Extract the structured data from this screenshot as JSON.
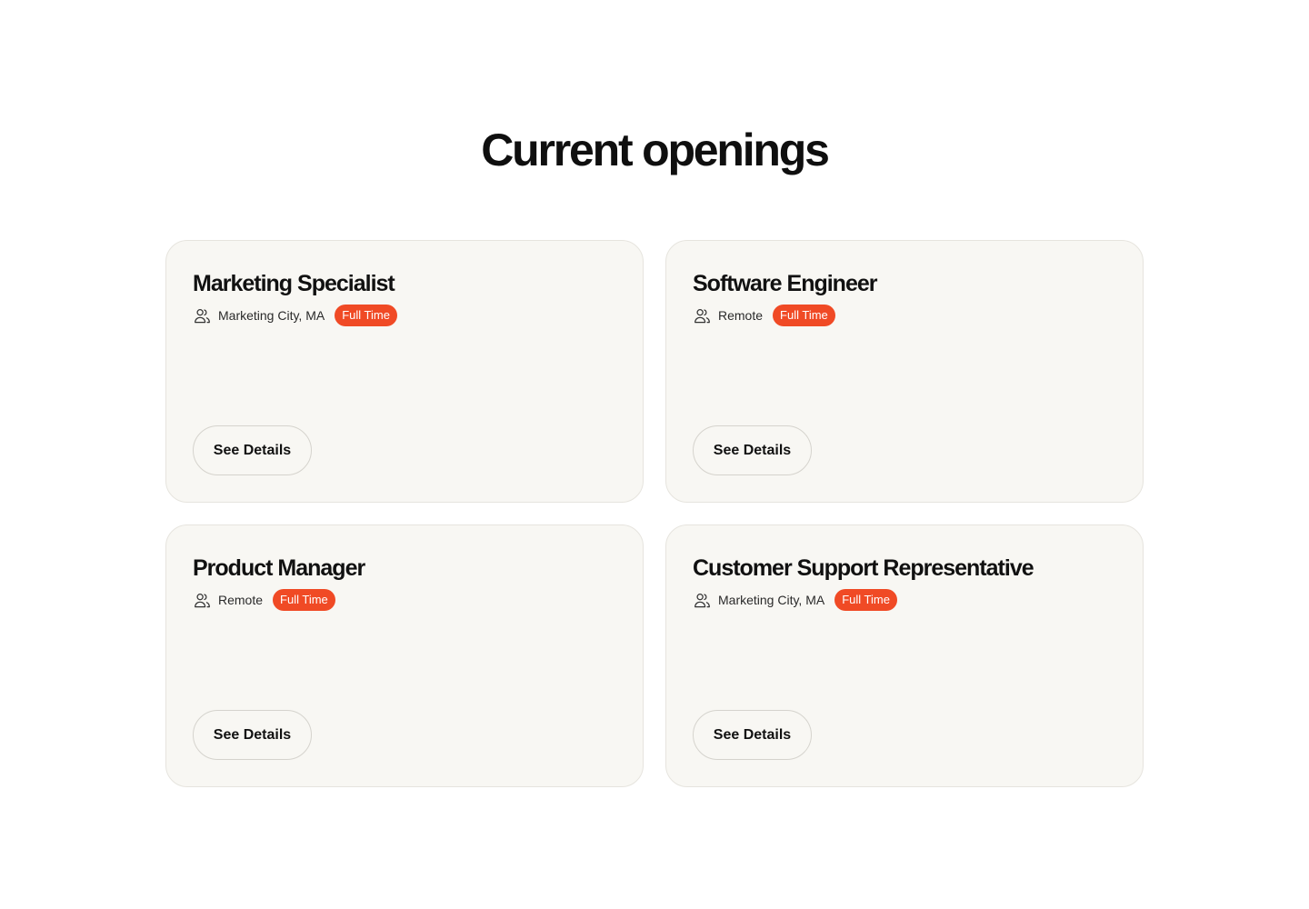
{
  "section": {
    "title": "Current openings"
  },
  "jobs": [
    {
      "title": "Marketing Specialist",
      "location": "Marketing City, MA",
      "type": "Full Time",
      "button_label": "See Details"
    },
    {
      "title": "Software Engineer",
      "location": "Remote",
      "type": "Full Time",
      "button_label": "See Details"
    },
    {
      "title": "Product Manager",
      "location": "Remote",
      "type": "Full Time",
      "button_label": "See Details"
    },
    {
      "title": "Customer Support Representative",
      "location": "Marketing City, MA",
      "type": "Full Time",
      "button_label": "See Details"
    }
  ],
  "icons": {
    "location_icon": "users-icon"
  },
  "colors": {
    "accent": "#f04a25",
    "card_background": "#f8f7f3",
    "card_border": "#e6e4de",
    "text": "#111111"
  }
}
